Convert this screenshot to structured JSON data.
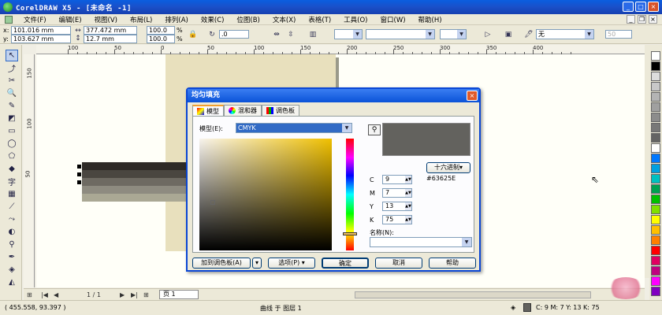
{
  "window": {
    "title": "CorelDRAW X5 - [未命名 -1]"
  },
  "menu": [
    "文件(F)",
    "编辑(E)",
    "视图(V)",
    "布局(L)",
    "排列(A)",
    "效果(C)",
    "位图(B)",
    "文本(X)",
    "表格(T)",
    "工具(O)",
    "窗口(W)",
    "帮助(H)"
  ],
  "propbar": {
    "x_label": "x:",
    "x": "101.016 mm",
    "y_label": "y:",
    "y": "103.627 mm",
    "w": "377.472 mm",
    "h": "12.7 mm",
    "scale_x": "100.0",
    "scale_y": "100.0",
    "percent": "%",
    "angle": ".0",
    "outline_value": "无",
    "size_value": "50"
  },
  "ruler_h": [
    "100",
    "50",
    "0",
    "50",
    "100",
    "150",
    "200",
    "250",
    "300",
    "350",
    "400"
  ],
  "ruler_v": [
    "150",
    "100",
    "50"
  ],
  "page_nav": {
    "counter": "1 / 1",
    "tab": "页 1"
  },
  "status": {
    "coords": "( 455.558, 93.397 )",
    "object_info": "曲线 于 图层 1",
    "fill_info": "C: 9 M: 7 Y: 13 K: 75"
  },
  "dialog": {
    "title": "均匀填充",
    "tabs": [
      "模型",
      "混和器",
      "调色板"
    ],
    "model_label": "模型(E):",
    "model_value": "CMYK",
    "hex_button": "十六进制▾",
    "hex_value": "#63625E",
    "preview_color": "#63625e",
    "cmyk": [
      {
        "label": "C",
        "value": "9"
      },
      {
        "label": "M",
        "value": "7"
      },
      {
        "label": "Y",
        "value": "13"
      },
      {
        "label": "K",
        "value": "75"
      }
    ],
    "name_label": "名称(N):",
    "buttons": {
      "add_palette": "加到调色板(A)",
      "options": "选项(P) ▾",
      "ok": "确定",
      "cancel": "取消",
      "help": "帮助"
    }
  },
  "canvas_stripes": [
    "#2e2a26",
    "#4a4640",
    "#6e6a62",
    "#8e8b80",
    "#aaa894"
  ],
  "palette_colors": [
    "#ffffff",
    "#000000",
    "#dcdcdc",
    "#c8c8c8",
    "#b4b4b4",
    "#a0a0a0",
    "#8c8c8c",
    "#787878",
    "#646464",
    "#ffffff",
    "#0078ff",
    "#00a0e0",
    "#00c0c0",
    "#00a050",
    "#00c000",
    "#80e000",
    "#ffff00",
    "#ffc000",
    "#ff8000",
    "#ff0000",
    "#e00060",
    "#c00080",
    "#ff00ff",
    "#8000c0"
  ]
}
